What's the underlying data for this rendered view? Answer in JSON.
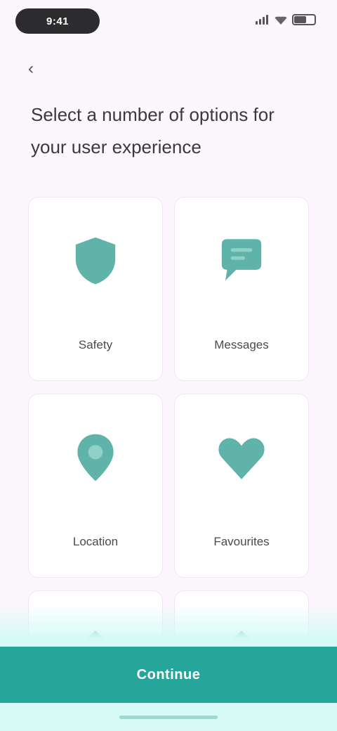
{
  "status_bar": {
    "time": "9:41",
    "icons": [
      "signal-icon",
      "wifi-icon",
      "battery-icon"
    ]
  },
  "header": {
    "back_label": "‹"
  },
  "question": {
    "text": "Select a number of options for your user experience"
  },
  "options": [
    {
      "label": "Safety",
      "icon": "shield-icon"
    },
    {
      "label": "Messages",
      "icon": "chat-icon"
    },
    {
      "label": "Location",
      "icon": "location-pin-icon"
    },
    {
      "label": "Favourites",
      "icon": "heart-icon"
    }
  ],
  "partial_options": [
    {
      "icon": "home-icon"
    },
    {
      "icon": "home-icon"
    }
  ],
  "footer": {
    "continue_label": "Continue"
  },
  "colors": {
    "accent": "#26a69a",
    "accent_light": "#d6faf6",
    "background": "#fcf7fc"
  }
}
